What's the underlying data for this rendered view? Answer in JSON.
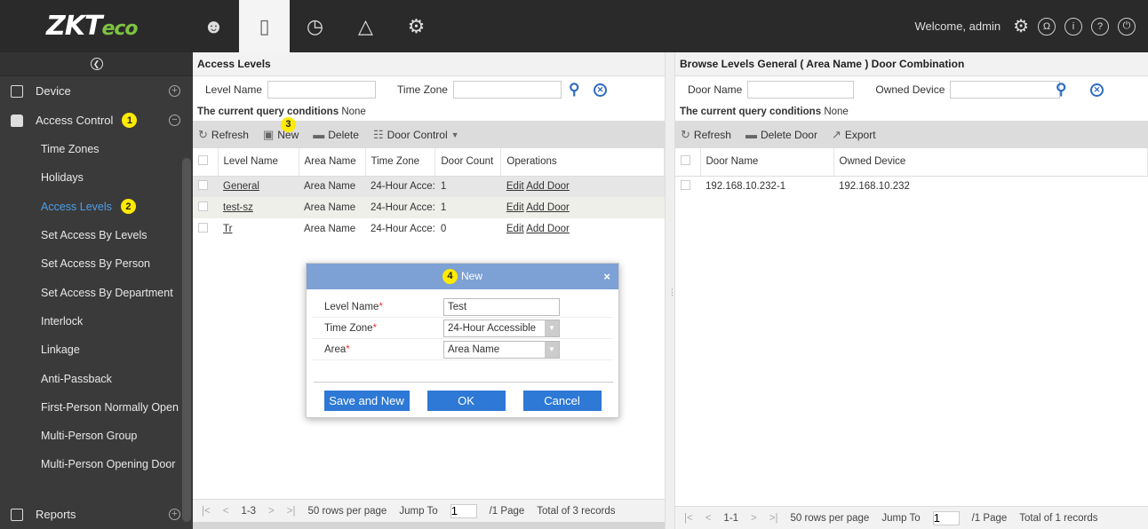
{
  "brand": {
    "logo_main": "ZK",
    "logo_t": "T",
    "logo_eco": "eco"
  },
  "header": {
    "nav_icons": [
      "person-icon",
      "door-icon",
      "clock-icon",
      "camera-icon",
      "settings-icon"
    ],
    "welcome": "Welcome, admin",
    "right_icons": [
      "gear-icon",
      "user-circle-icon",
      "info-icon",
      "help-icon",
      "power-icon"
    ]
  },
  "sidebar": {
    "device_label": "Device",
    "access_control_label": "Access Control",
    "access_control_badge": "1",
    "reports_label": "Reports",
    "items": [
      {
        "label": "Time Zones"
      },
      {
        "label": "Holidays"
      },
      {
        "label": "Access Levels",
        "badge": "2"
      },
      {
        "label": "Set Access By Levels"
      },
      {
        "label": "Set Access By Person"
      },
      {
        "label": "Set Access By Department"
      },
      {
        "label": "Interlock"
      },
      {
        "label": "Linkage"
      },
      {
        "label": "Anti-Passback"
      },
      {
        "label": "First-Person Normally Open"
      },
      {
        "label": "Multi-Person Group"
      },
      {
        "label": "Multi-Person Opening Door"
      }
    ]
  },
  "left": {
    "title": "Access Levels",
    "query": {
      "level_name_label": "Level Name",
      "time_zone_label": "Time Zone"
    },
    "conditions_label": "The current query conditions",
    "conditions_value": "None",
    "toolbar": {
      "refresh": "Refresh",
      "new": "New",
      "new_badge": "3",
      "delete": "Delete",
      "door_control": "Door Control"
    },
    "columns": [
      "Level Name",
      "Area Name",
      "Time Zone",
      "Door Count",
      "Operations"
    ],
    "rows": [
      {
        "name": "General",
        "area": "Area Name",
        "tz": "24-Hour Acce:",
        "count": "1",
        "edit": "Edit",
        "add": "Add Door"
      },
      {
        "name": "test-sz",
        "area": "Area Name",
        "tz": "24-Hour Acce:",
        "count": "1",
        "edit": "Edit",
        "add": "Add Door"
      },
      {
        "name": "Tr",
        "area": "Area Name",
        "tz": "24-Hour Acce:",
        "count": "0",
        "edit": "Edit",
        "add": "Add Door"
      }
    ],
    "pager": {
      "range": "1-3",
      "rows_per_page": "50 rows per page",
      "jump_to": "Jump To",
      "page_value": "1",
      "pages": "/1 Page",
      "total": "Total of 3 records"
    }
  },
  "right": {
    "title": "Browse Levels General ( Area Name ) Door Combination",
    "query": {
      "door_name_label": "Door Name",
      "owned_device_label": "Owned Device"
    },
    "conditions_label": "The current query conditions",
    "conditions_value": "None",
    "toolbar": {
      "refresh": "Refresh",
      "delete_door": "Delete Door",
      "export": "Export"
    },
    "columns": [
      "Door Name",
      "Owned Device"
    ],
    "rows": [
      {
        "door": "192.168.10.232-1",
        "device": "192.168.10.232"
      }
    ],
    "pager": {
      "range": "1-1",
      "rows_per_page": "50 rows per page",
      "jump_to": "Jump To",
      "page_value": "1",
      "pages": "/1 Page",
      "total": "Total of 1 records"
    }
  },
  "dialog": {
    "title": "New",
    "badge": "4",
    "close": "×",
    "fields": {
      "level_name_label": "Level Name",
      "level_name_value": "Test",
      "time_zone_label": "Time Zone",
      "time_zone_value": "24-Hour Accessible",
      "area_label": "Area",
      "area_value": "Area Name"
    },
    "buttons": {
      "save_new": "Save and New",
      "ok": "OK",
      "cancel": "Cancel"
    }
  }
}
